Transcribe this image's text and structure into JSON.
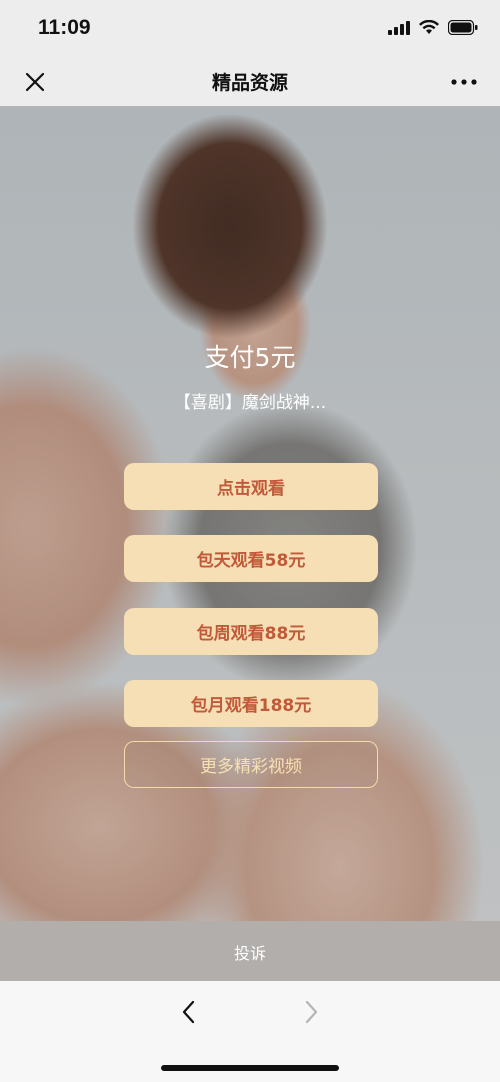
{
  "status_bar": {
    "time": "11:09",
    "icons": [
      "signal-icon",
      "wifi-icon",
      "battery-icon"
    ]
  },
  "nav": {
    "title": "精品资源",
    "close_icon": "close-icon",
    "more_icon": "more-icon"
  },
  "main": {
    "pay_title": "支付5元",
    "video_title": "【喜剧】魔剑战神...",
    "buttons": [
      {
        "label": "点击观看"
      },
      {
        "label": "包天观看58元"
      },
      {
        "label": "包周观看88元"
      },
      {
        "label": "包月观看188元"
      }
    ],
    "more_button": "更多精彩视频"
  },
  "footer": {
    "report_label": "投诉"
  },
  "toolbar": {
    "back_icon": "chevron-left-icon",
    "forward_icon": "chevron-right-icon"
  },
  "colors": {
    "button_bg": "#f6dfb4",
    "button_text": "#c05a3a",
    "outline_border": "#f4dca8"
  }
}
